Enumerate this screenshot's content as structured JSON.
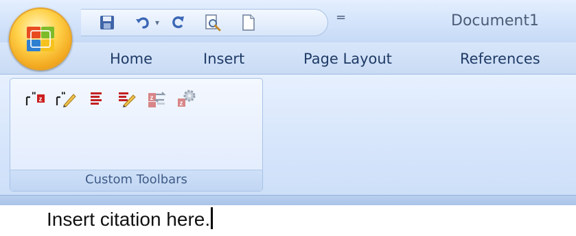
{
  "window": {
    "document_title": "Document1"
  },
  "office_button": {
    "icon": "office-logo-icon"
  },
  "quick_access": {
    "items": [
      {
        "icon": "save-icon"
      },
      {
        "icon": "undo-icon"
      },
      {
        "icon": "redo-icon"
      },
      {
        "icon": "print-preview-icon"
      },
      {
        "icon": "new-document-icon"
      }
    ],
    "undo_dropdown_glyph": "▾",
    "customize_glyph": "="
  },
  "tabs": [
    {
      "label": "Home"
    },
    {
      "label": "Insert"
    },
    {
      "label": "Page Layout"
    },
    {
      "label": "References"
    }
  ],
  "ribbon": {
    "group": {
      "label": "Custom Toolbars",
      "icons": [
        "insert-citation-icon",
        "edit-citation-icon",
        "bibliography-icon",
        "edit-bibliography-icon",
        "sync-icon",
        "settings-icon"
      ]
    }
  },
  "document": {
    "body_text": "Insert citation here."
  },
  "colors": {
    "accent": "#f2a81f",
    "ribbon": "#d6e5fb",
    "tab_text": "#1e3a66"
  }
}
